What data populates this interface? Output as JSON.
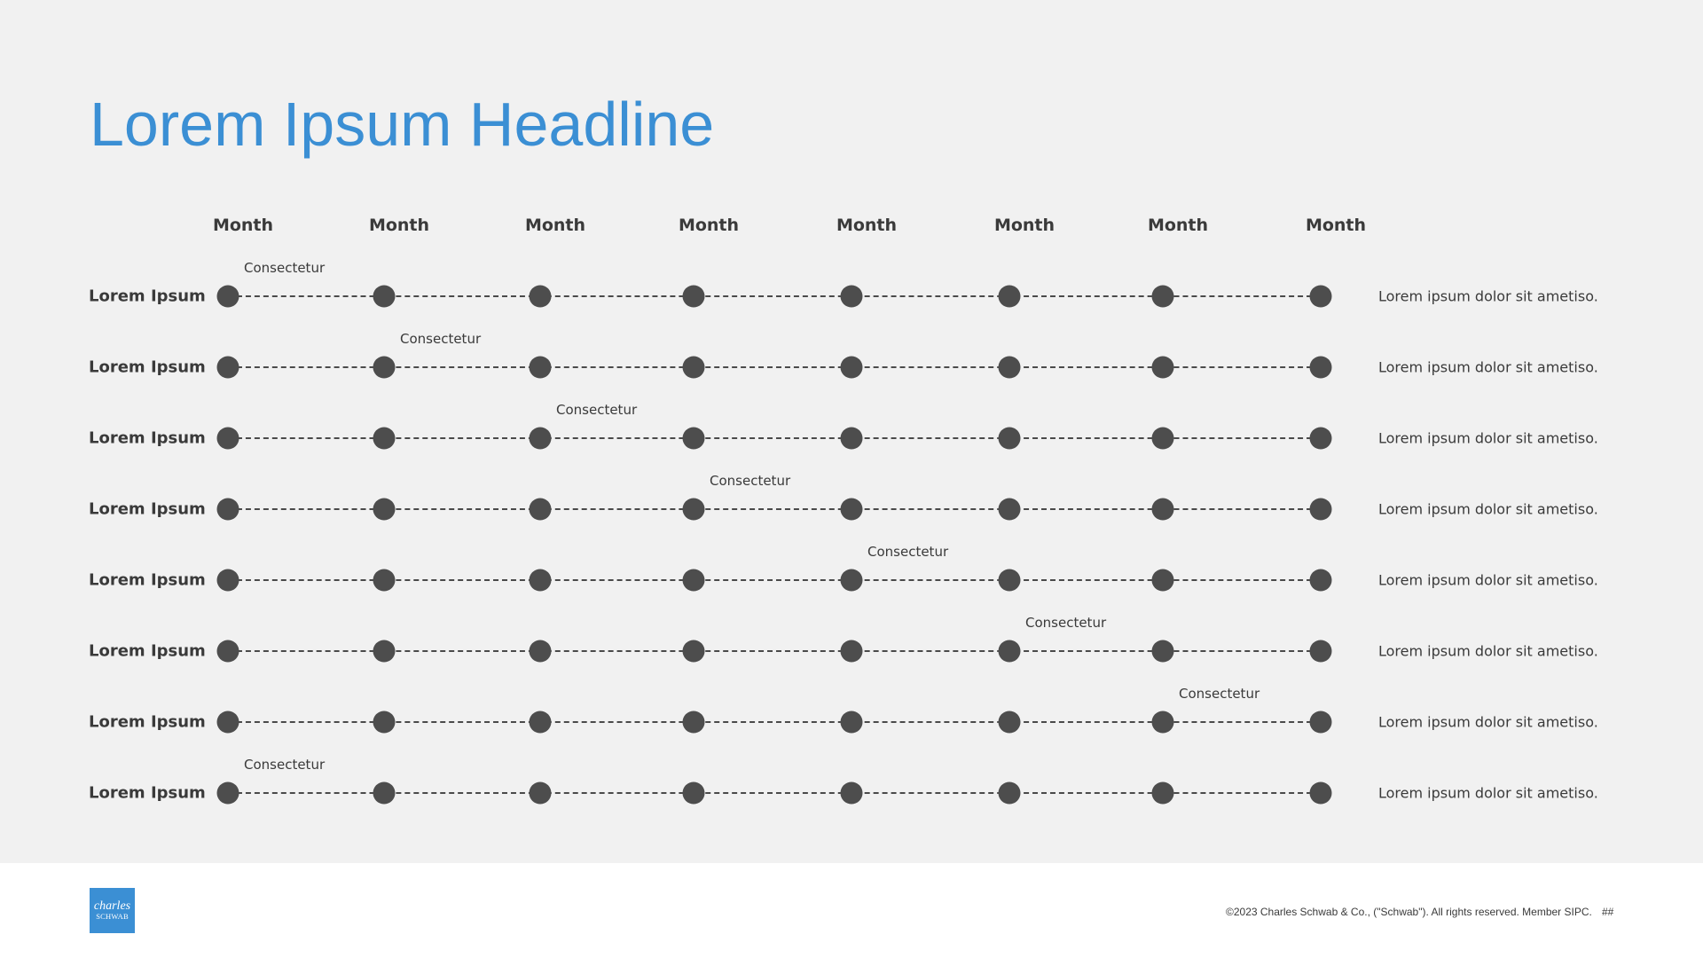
{
  "headline": "Lorem Ipsum Headline",
  "months": [
    "Month",
    "Month",
    "Month",
    "Month",
    "Month",
    "Month",
    "Month",
    "Month"
  ],
  "rows": [
    {
      "label": "Lorem Ipsum",
      "callout": "Consectetur",
      "callout_index": 0,
      "note": "Lorem ipsum dolor sit ametiso."
    },
    {
      "label": "Lorem Ipsum",
      "callout": "Consectetur",
      "callout_index": 1,
      "note": "Lorem ipsum dolor sit ametiso."
    },
    {
      "label": "Lorem Ipsum",
      "callout": "Consectetur",
      "callout_index": 2,
      "note": "Lorem ipsum dolor sit ametiso."
    },
    {
      "label": "Lorem Ipsum",
      "callout": "Consectetur",
      "callout_index": 3,
      "note": "Lorem ipsum dolor sit ametiso."
    },
    {
      "label": "Lorem Ipsum",
      "callout": "Consectetur",
      "callout_index": 4,
      "note": "Lorem ipsum dolor sit ametiso."
    },
    {
      "label": "Lorem Ipsum",
      "callout": "Consectetur",
      "callout_index": 5,
      "note": "Lorem ipsum dolor sit ametiso."
    },
    {
      "label": "Lorem Ipsum",
      "callout": "Consectetur",
      "callout_index": 6,
      "note": "Lorem ipsum dolor sit ametiso."
    },
    {
      "label": "Lorem Ipsum",
      "callout": "Consectetur",
      "callout_index": 0,
      "note": "Lorem ipsum dolor sit ametiso."
    }
  ],
  "footer": {
    "logo_top": "charles",
    "logo_bottom": "SCHWAB",
    "copyright": "©2023 Charles Schwab & Co., (\"Schwab\"). All rights reserved. Member SIPC.",
    "page_number": "##"
  },
  "colors": {
    "accent": "#3b8fd4",
    "dot": "#4d4d4d",
    "text": "#3a3a3a",
    "slide_background": "#f1f1f1"
  },
  "icons": {
    "logo": "charles-schwab-logo"
  }
}
